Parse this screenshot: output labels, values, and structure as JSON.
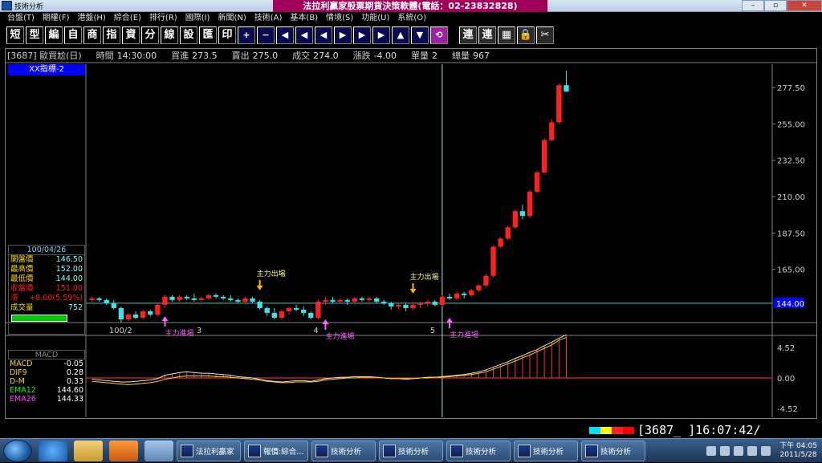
{
  "window": {
    "title": "技術分析",
    "brand_banner": "法拉利贏家股票期貨決策軟體(電話：02-23832828)",
    "controls": [
      "–",
      "▫",
      "✕"
    ]
  },
  "menu": [
    "台盤(T)",
    "期權(F)",
    "港盤(H)",
    "綜合(E)",
    "排行(R)",
    "國際(I)",
    "新聞(N)",
    "技術(A)",
    "基本(B)",
    "情境(S)",
    "功能(U)",
    "系統(O)"
  ],
  "toolbar": {
    "text_buttons": [
      "短",
      "型",
      "編",
      "自",
      "商",
      "指",
      "資",
      "分",
      "線",
      "設",
      "匯",
      "印"
    ],
    "symbol_buttons": [
      "+",
      "−",
      "◀",
      "◀",
      "◀",
      "▶",
      "▶",
      "▶",
      "▲",
      "▼",
      "⟲"
    ],
    "right_buttons": [
      "連",
      "連",
      "▦",
      "🔒",
      "✂"
    ]
  },
  "info_bar": {
    "symbol": "[3687] 歐買尬(日)",
    "time_label": "時間",
    "time": "14:30:00",
    "bid_label": "買進",
    "bid": "273.5",
    "ask_label": "賣出",
    "ask": "275.0",
    "trade_label": "成交",
    "trade": "274.0",
    "change_label": "漲跌",
    "change": "-4.00",
    "unit_vol_label": "單量",
    "unit_vol": "2",
    "total_vol_label": "總量",
    "total_vol": "967"
  },
  "indicator_label": "XX指標-2",
  "data_panel": {
    "date": "100/04/26",
    "rows": [
      {
        "label": "開盤價",
        "value": "146.50"
      },
      {
        "label": "最高價",
        "value": "152.00"
      },
      {
        "label": "最低價",
        "value": "144.00"
      },
      {
        "label": "收盤價",
        "value": "151.00"
      },
      {
        "label": "漲",
        "value": "+8.00(5.59%)"
      },
      {
        "label": "成交量",
        "value": "752"
      }
    ]
  },
  "macd_panel": {
    "title": "MACD",
    "rows": [
      {
        "label": "MACD",
        "value": "-0.05",
        "color": "#ffd700"
      },
      {
        "label": "DIF9",
        "value": "0.28",
        "color": "#ffd700"
      },
      {
        "label": "D-M",
        "value": "0.33",
        "color": "#ffd700"
      },
      {
        "label": "EMA12",
        "value": "144.60",
        "color": "#00ff00"
      },
      {
        "label": "EMA26",
        "value": "144.33",
        "color": "#ff40ff"
      }
    ]
  },
  "price_axis": {
    "ticks": [
      "277.50",
      "255.00",
      "232.50",
      "210.00",
      "187.50",
      "165.00"
    ],
    "current_price": "144.00"
  },
  "macd_axis": {
    "ticks": [
      "4.52",
      "0.00",
      "-4.52"
    ]
  },
  "time_axis": [
    "100/2",
    "3",
    "4",
    "5"
  ],
  "annotations": [
    {
      "text": "主力進場",
      "type": "enter"
    },
    {
      "text": "主力出場",
      "type": "exit"
    },
    {
      "text": "主力進場",
      "type": "enter"
    },
    {
      "text": "主力出場",
      "type": "exit"
    },
    {
      "text": "主力進場",
      "type": "enter"
    }
  ],
  "colors": {
    "up": "#ff2020",
    "down": "#40e0e0",
    "enter": "#ff60ff",
    "exit": "#ffb000",
    "axis": "#808080"
  },
  "chart_data": {
    "type": "candlestick",
    "title": "[3687] 歐買尬(日)",
    "ylim": [
      136,
      290
    ],
    "candles": [
      [
        146,
        148,
        145,
        147
      ],
      [
        147,
        148,
        145,
        146
      ],
      [
        146,
        147,
        143,
        144
      ],
      [
        144,
        146,
        140,
        141
      ],
      [
        141,
        142,
        132,
        134
      ],
      [
        134,
        138,
        133,
        137
      ],
      [
        137,
        139,
        134,
        135
      ],
      [
        135,
        140,
        134,
        139
      ],
      [
        139,
        140,
        136,
        137
      ],
      [
        137,
        144,
        136,
        143
      ],
      [
        143,
        149,
        141,
        148
      ],
      [
        148,
        149,
        145,
        146
      ],
      [
        146,
        149,
        145,
        148
      ],
      [
        148,
        149,
        146,
        147
      ],
      [
        147,
        150,
        145,
        146
      ],
      [
        146,
        148,
        145,
        147
      ],
      [
        147,
        150,
        146,
        149
      ],
      [
        149,
        150,
        147,
        148
      ],
      [
        148,
        149,
        146,
        147
      ],
      [
        147,
        149,
        145,
        146
      ],
      [
        146,
        147,
        144,
        145
      ],
      [
        145,
        148,
        144,
        147
      ],
      [
        147,
        148,
        144,
        145
      ],
      [
        145,
        146,
        140,
        141
      ],
      [
        141,
        142,
        136,
        138
      ],
      [
        138,
        141,
        134,
        135
      ],
      [
        135,
        140,
        134,
        139
      ],
      [
        139,
        142,
        137,
        141
      ],
      [
        141,
        143,
        139,
        140
      ],
      [
        140,
        142,
        136,
        138
      ],
      [
        138,
        139,
        134,
        135
      ],
      [
        135,
        146,
        134,
        145
      ],
      [
        145,
        148,
        143,
        146
      ],
      [
        146,
        148,
        144,
        145
      ],
      [
        145,
        147,
        144,
        146
      ],
      [
        146,
        147,
        143,
        145
      ],
      [
        145,
        148,
        144,
        147
      ],
      [
        147,
        148,
        145,
        146
      ],
      [
        146,
        148,
        145,
        147
      ],
      [
        147,
        148,
        144,
        145
      ],
      [
        145,
        146,
        143,
        144
      ],
      [
        144,
        145,
        140,
        142
      ],
      [
        142,
        144,
        140,
        143
      ],
      [
        143,
        144,
        139,
        141
      ],
      [
        141,
        144,
        140,
        143
      ],
      [
        143,
        145,
        141,
        144
      ],
      [
        144,
        146,
        142,
        145
      ],
      [
        145,
        146,
        142,
        143
      ],
      [
        143,
        149,
        142,
        148
      ],
      [
        148,
        150,
        146,
        147
      ],
      [
        147,
        151,
        146,
        150
      ],
      [
        150,
        151,
        147,
        149
      ],
      [
        149,
        153,
        148,
        152
      ],
      [
        152,
        156,
        151,
        155
      ],
      [
        155,
        162,
        154,
        161
      ],
      [
        161,
        180,
        160,
        179
      ],
      [
        179,
        185,
        178,
        184
      ],
      [
        184,
        192,
        183,
        191
      ],
      [
        191,
        202,
        190,
        201
      ],
      [
        201,
        205,
        196,
        198
      ],
      [
        198,
        214,
        197,
        213
      ],
      [
        213,
        226,
        212,
        225
      ],
      [
        225,
        246,
        224,
        245
      ],
      [
        245,
        258,
        244,
        256
      ],
      [
        256,
        280,
        255,
        279
      ],
      [
        279,
        288,
        276,
        275
      ]
    ],
    "macd": [
      -0.2,
      -0.3,
      -0.4,
      -0.5,
      -0.6,
      -0.6,
      -0.5,
      -0.4,
      -0.3,
      -0.1,
      0.4,
      0.6,
      0.8,
      0.9,
      0.8,
      0.7,
      0.7,
      0.6,
      0.5,
      0.4,
      0.2,
      0.1,
      0.0,
      -0.2,
      -0.4,
      -0.5,
      -0.6,
      -0.5,
      -0.4,
      -0.4,
      -0.5,
      -0.3,
      -0.1,
      0.0,
      0.1,
      0.1,
      0.2,
      0.2,
      0.2,
      0.1,
      0.0,
      -0.1,
      -0.1,
      -0.2,
      -0.1,
      0.0,
      0.1,
      0.1,
      0.2,
      0.3,
      0.4,
      0.5,
      0.7,
      0.9,
      1.2,
      1.6,
      2.0,
      2.4,
      2.9,
      3.3,
      3.8,
      4.2,
      4.8,
      5.3,
      5.9,
      6.4
    ],
    "dif": [
      -0.5,
      -0.6,
      -0.7,
      -0.8,
      -0.9,
      -1.0,
      -0.9,
      -0.8,
      -0.7,
      -0.5,
      -0.2,
      0.0,
      0.2,
      0.3,
      0.3,
      0.3,
      0.3,
      0.2,
      0.2,
      0.1,
      0.0,
      -0.1,
      -0.2,
      -0.3,
      -0.5,
      -0.6,
      -0.7,
      -0.7,
      -0.6,
      -0.6,
      -0.6,
      -0.5,
      -0.3,
      -0.2,
      -0.1,
      0.0,
      0.0,
      0.1,
      0.1,
      0.1,
      0.0,
      -0.1,
      -0.1,
      -0.1,
      -0.1,
      0.0,
      0.0,
      0.1,
      0.1,
      0.2,
      0.3,
      0.4,
      0.5,
      0.7,
      0.9,
      1.3,
      1.7,
      2.1,
      2.5,
      3.0,
      3.4,
      3.9,
      4.4,
      4.9,
      5.6,
      6.0
    ],
    "xlabel": "",
    "ylabel": ""
  },
  "status": {
    "code": "[3687_  ]16:07:42/",
    "swatches": [
      "#00e0ff",
      "#ffff00",
      "#ff2020",
      "#ff0000"
    ]
  },
  "taskbar": {
    "tasks": [
      "法拉利贏家",
      "報價:綜合...",
      "技術分析",
      "技術分析",
      "技術分析",
      "技術分析",
      "技術分析"
    ],
    "clock_time": "下午 04:05",
    "clock_date": "2011/5/28"
  }
}
